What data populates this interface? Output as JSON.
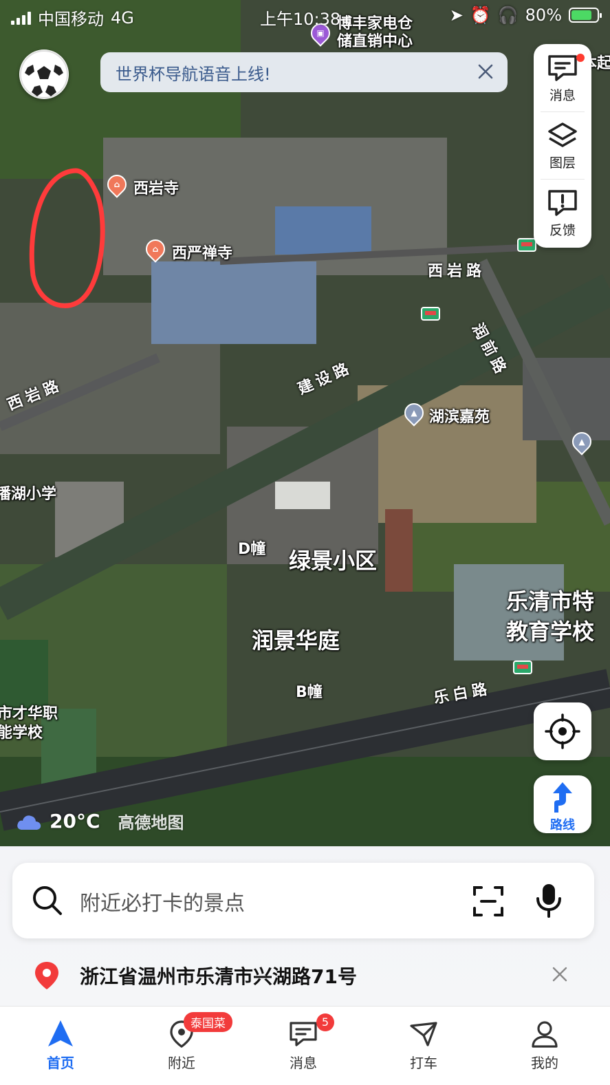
{
  "status_bar": {
    "carrier": "中国移动",
    "network": "4G",
    "time": "上午10:38",
    "battery": "80%"
  },
  "notice": {
    "text": "世界杯导航语音上线!"
  },
  "side_controls": {
    "messages": "消息",
    "layers": "图层",
    "feedback": "反馈"
  },
  "map": {
    "pois": {
      "shop": "博丰家电仓储直销中心",
      "temple1": "西岩寺",
      "temple2": "西严禅寺",
      "community1": "湖滨嘉苑",
      "building_d": "D幢",
      "community2": "绿景小区",
      "community3": "润景华庭",
      "building_b": "B幢",
      "school1": "乐清市特教育学校",
      "school2": "潘湖小学",
      "school3": "市才华职能学校",
      "edge_top": "本起"
    },
    "roads": {
      "xiyan1": "西岩路",
      "xiyan2": "西岩路",
      "jianshe": "建设路",
      "runqian": "润前路",
      "lebai": "乐白路"
    }
  },
  "route_button": "路线",
  "weather": {
    "temp": "20°C",
    "brand": "高德地图"
  },
  "search": {
    "placeholder": "附近必打卡的景点"
  },
  "address": {
    "text": "浙江省温州市乐清市兴湖路71号"
  },
  "tabs": [
    {
      "label": "首页"
    },
    {
      "label": "附近",
      "tag": "泰国菜"
    },
    {
      "label": "消息",
      "badge": "5"
    },
    {
      "label": "打车"
    },
    {
      "label": "我的"
    }
  ],
  "colors": {
    "accent": "#1f6df2",
    "alert": "#f23b3b",
    "annotation": "#ff3b3b"
  }
}
